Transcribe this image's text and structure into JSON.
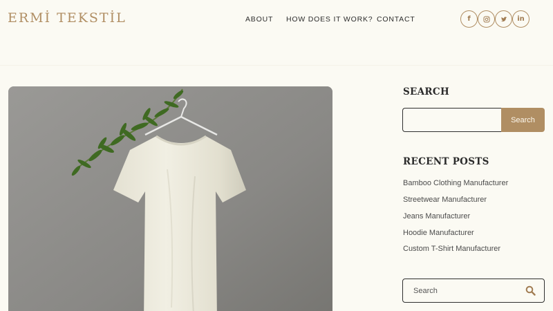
{
  "header": {
    "logo": "ERMİ TEKSTİL",
    "nav": [
      {
        "label": "ABOUT"
      },
      {
        "label": "HOW DOES IT WORK?"
      },
      {
        "label": "CONTACT"
      }
    ],
    "social": [
      {
        "icon": "facebook-icon",
        "glyph": "f"
      },
      {
        "icon": "instagram-icon",
        "glyph": ""
      },
      {
        "icon": "twitter-icon",
        "glyph": ""
      },
      {
        "icon": "linkedin-icon",
        "glyph": "in"
      }
    ]
  },
  "sidebar": {
    "search_title": "SEARCH",
    "search_button": "Search",
    "search_value": "",
    "recent_title": "RECENT POSTS",
    "recent_posts": [
      "Bamboo Clothing Manufacturer",
      "Streetwear Manufacturer",
      "Jeans Manufacturer",
      "Hoodie Manufacturer",
      "Custom T-Shirt Manufacturer"
    ],
    "search2_placeholder": "Search"
  },
  "colors": {
    "background": "#fbfaf3",
    "accent": "#b08e63",
    "text": "#2b2b2b"
  }
}
